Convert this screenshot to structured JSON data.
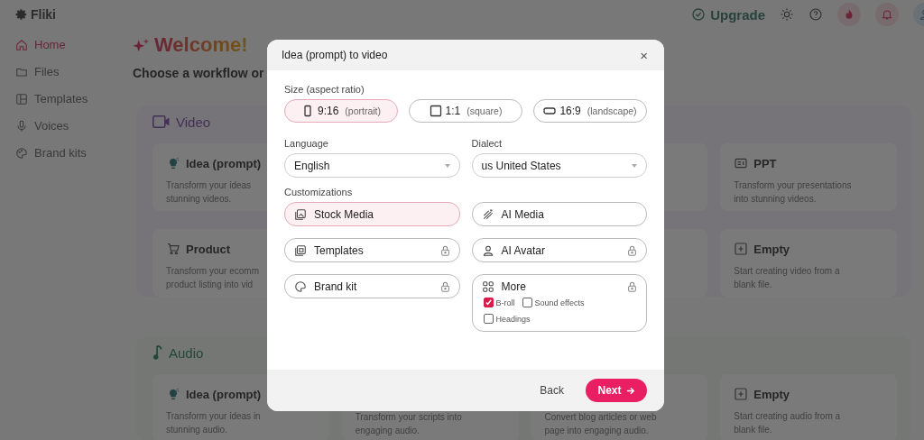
{
  "app": {
    "logo": "Fliki",
    "upgrade": "Upgrade"
  },
  "sidebar": {
    "items": [
      {
        "label": "Home",
        "kind": "home",
        "selected": true
      },
      {
        "label": "Files",
        "kind": "files",
        "selected": false
      },
      {
        "label": "Templates",
        "kind": "templates",
        "selected": false
      },
      {
        "label": "Voices",
        "kind": "voices",
        "selected": false
      },
      {
        "label": "Brand kits",
        "kind": "brand",
        "selected": false
      }
    ]
  },
  "main": {
    "title": "Welcome!",
    "subtitle": "Choose a workflow or",
    "sections": [
      {
        "kind": "video",
        "title": "Video",
        "rows": [
          [
            {
              "kind": "idea",
              "title": "Idea (prompt)",
              "desc": [
                "Transform your ideas",
                "stunning videos."
              ]
            },
            null,
            {},
            {
              "kind": "ppt",
              "title": "PPT",
              "desc": [
                "Transform your presentations",
                "into stunning videos."
              ]
            }
          ],
          [
            {
              "kind": "product",
              "title": "Product",
              "desc": [
                "Transform your ecomm",
                "product listing into vid"
              ]
            },
            null,
            {},
            {
              "kind": "empty",
              "title": "Empty",
              "desc": [
                "Start creating video from a",
                "blank file."
              ]
            }
          ]
        ]
      },
      {
        "kind": "audio",
        "title": "Audio",
        "rows": [
          [
            {
              "kind": "idea",
              "title": "Idea (prompt)",
              "desc": [
                "Transform your ideas in",
                "stunning audio."
              ]
            },
            {
              "desc": [
                "Transform your scripts into",
                "engaging audio."
              ]
            },
            {
              "desc": [
                "Convert blog articles or web",
                "page into engaging audio."
              ]
            },
            {
              "kind": "empty",
              "title": "Empty",
              "desc": [
                "Start creating audio from a",
                "blank file."
              ]
            }
          ]
        ]
      }
    ]
  },
  "dialog": {
    "title": "Idea (prompt) to video",
    "close": "×",
    "size_label": "Size (aspect ratio)",
    "sizes": [
      {
        "kind": "portrait",
        "ratio": "9:16",
        "label": "(portrait)",
        "selected": true
      },
      {
        "kind": "square",
        "ratio": "1:1",
        "label": "(square)",
        "selected": false
      },
      {
        "kind": "landscape",
        "ratio": "16:9",
        "label": "(landscape)",
        "selected": false
      }
    ],
    "language": {
      "label": "Language",
      "value": "English"
    },
    "dialect": {
      "label": "Dialect",
      "value": "us United States"
    },
    "customizations_label": "Customizations",
    "customizations": [
      {
        "kind": "stock",
        "label": "Stock Media",
        "selected": true,
        "locked": false
      },
      {
        "kind": "ai-media",
        "label": "AI Media",
        "selected": false,
        "locked": false
      },
      {
        "kind": "templates",
        "label": "Templates",
        "selected": false,
        "locked": true
      },
      {
        "kind": "avatar",
        "label": "AI Avatar",
        "selected": false,
        "locked": true
      },
      {
        "kind": "brand",
        "label": "Brand kit",
        "selected": false,
        "locked": true
      },
      {
        "kind": "more",
        "label": "More",
        "selected": false,
        "locked": true,
        "options": [
          {
            "label": "B-roll",
            "checked": true
          },
          {
            "label": "Sound effects",
            "checked": false
          },
          {
            "label": "Headings",
            "checked": false
          }
        ]
      }
    ],
    "back": "Back",
    "next": "Next"
  }
}
